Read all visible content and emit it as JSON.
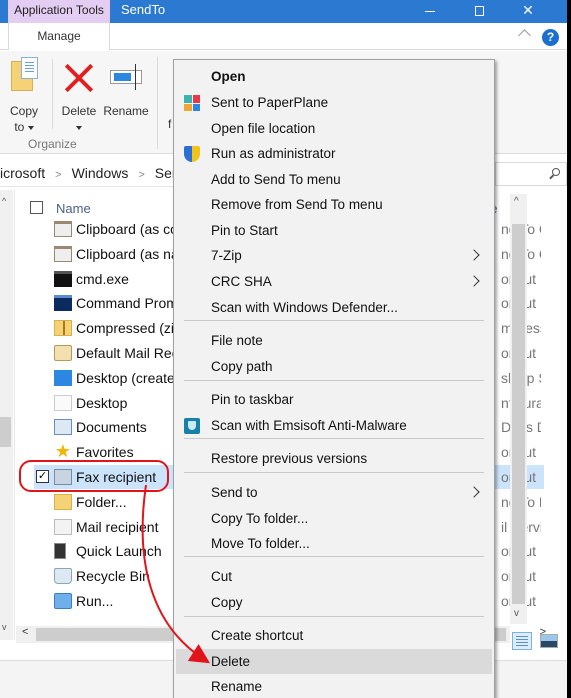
{
  "titlebar": {
    "contextual_tab": "Application Tools",
    "title": "SendTo",
    "minimize": "minimize",
    "maximize": "maximize",
    "close": "✕"
  },
  "ribbon": {
    "manage_tab": "Manage",
    "help": "?",
    "buttons": {
      "copy_to_line1": "Copy",
      "copy_to_line2": "to",
      "delete": "Delete",
      "rename": "Rename"
    },
    "group_label": "Organize",
    "partial_text": "f"
  },
  "address": {
    "crumbs": [
      "icrosoft",
      "Windows",
      "Sen"
    ]
  },
  "filelist": {
    "columns": {
      "name": "Name",
      "type": "pe"
    },
    "rows": [
      {
        "name": "Clipboard (as co",
        "type": "nd To Clip",
        "icon": "clipboard-icon",
        "selected": false
      },
      {
        "name": "Clipboard (as na",
        "type": "nd To Clip",
        "icon": "clipboard-icon",
        "selected": false
      },
      {
        "name": "cmd.exe",
        "type": "ortcut",
        "icon": "console-icon",
        "selected": false
      },
      {
        "name": "Command Prom",
        "type": "ortcut",
        "icon": "command-prompt-icon",
        "selected": false
      },
      {
        "name": "Compressed (zip",
        "type": "mpresse",
        "icon": "zip-folder-icon",
        "selected": false
      },
      {
        "name": "Default Mail Rec",
        "type": "ortcut",
        "icon": "mail-icon",
        "selected": false
      },
      {
        "name": "Desktop (create",
        "type": "sktop Sh",
        "icon": "desktop-icon",
        "selected": false
      },
      {
        "name": "Desktop",
        "type": "nfigurati",
        "icon": "document-icon",
        "selected": false
      },
      {
        "name": "Documents",
        "type": "Docs Dr",
        "icon": "documents-icon",
        "selected": false
      },
      {
        "name": "Favorites",
        "type": "ortcut",
        "icon": "star-icon",
        "selected": false
      },
      {
        "name": "Fax recipient",
        "type": "ortcut",
        "icon": "fax-icon",
        "selected": true
      },
      {
        "name": "Folder...",
        "type": "nd To Fol",
        "icon": "folder-icon",
        "selected": false
      },
      {
        "name": "Mail recipient",
        "type": "il Servic",
        "icon": "envelope-icon",
        "selected": false
      },
      {
        "name": "Quick Launch",
        "type": "ortcut",
        "icon": "quick-launch-icon",
        "selected": false
      },
      {
        "name": "Recycle Bin",
        "type": "ortcut",
        "icon": "recycle-bin-icon",
        "selected": false
      },
      {
        "name": "Run...",
        "type": "ortcut",
        "icon": "run-icon",
        "selected": false
      }
    ]
  },
  "context_menu": {
    "items": [
      {
        "label": "Open",
        "bold": true
      },
      {
        "label": "Sent to PaperPlane",
        "icon": "paperplane-icon"
      },
      {
        "label": "Open file location"
      },
      {
        "label": "Run as administrator",
        "icon": "uac-shield-icon"
      },
      {
        "label": "Add to Send To menu"
      },
      {
        "label": "Remove from Send To menu"
      },
      {
        "label": "Pin to Start"
      },
      {
        "label": "7-Zip",
        "submenu": true
      },
      {
        "label": "CRC SHA",
        "submenu": true
      },
      {
        "label": "Scan with Windows Defender..."
      },
      {
        "label": "File note"
      },
      {
        "label": "Copy path"
      },
      {
        "label": "Pin to taskbar"
      },
      {
        "label": "Scan with Emsisoft Anti-Malware",
        "icon": "emsisoft-icon"
      },
      {
        "label": "Restore previous versions"
      },
      {
        "label": "Send to",
        "submenu": true
      },
      {
        "label": "Copy To folder..."
      },
      {
        "label": "Move To folder..."
      },
      {
        "label": "Cut"
      },
      {
        "label": "Copy"
      },
      {
        "label": "Create shortcut"
      },
      {
        "label": "Delete",
        "highlighted": true
      },
      {
        "label": "Rename"
      }
    ]
  },
  "colors": {
    "titlebar": "#2b79d0",
    "contextual_tab": "#e4cdf2",
    "selection": "#cce4fb",
    "annotation": "#e0141a",
    "menu_highlight": "#dadada"
  }
}
